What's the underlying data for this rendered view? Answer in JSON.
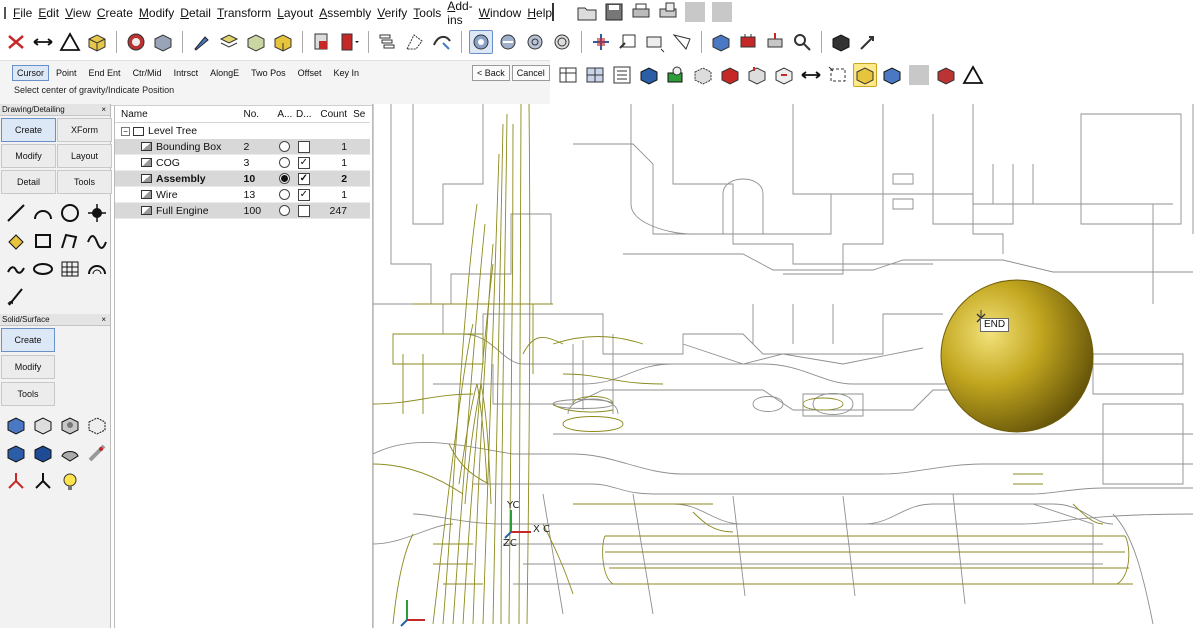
{
  "menubar": {
    "items": [
      "File",
      "Edit",
      "View",
      "Create",
      "Modify",
      "Detail",
      "Transform",
      "Layout",
      "Assembly",
      "Verify",
      "Tools",
      "Add-ins",
      "Window",
      "Help"
    ]
  },
  "snap_bar": {
    "modes": [
      "Cursor",
      "Point",
      "End Ent",
      "Ctr/Mid",
      "Intrsct",
      "AlongE",
      "Two Pos",
      "Offset",
      "Key In"
    ],
    "active_mode": "Cursor",
    "back_label": "< Back",
    "cancel_label": "Cancel",
    "prompt": "Select center of gravity/Indicate Position"
  },
  "palette": {
    "drawing_title": "Drawing/Detailing",
    "drawing_tabs": [
      "Create",
      "XForm",
      "Modify",
      "Layout",
      "Detail",
      "Tools"
    ],
    "solid_title": "Solid/Surface",
    "solid_tabs": [
      "Create",
      "Modify",
      "Tools"
    ],
    "close_glyph": "×"
  },
  "level_tree": {
    "columns": {
      "name": "Name",
      "no": "No.",
      "active": "A...",
      "display": "D...",
      "count": "Count",
      "se": "Se"
    },
    "root_label": "Level Tree",
    "rows": [
      {
        "name": "Bounding Box",
        "no": "2",
        "count": "1",
        "display": false,
        "active": false,
        "bold": false
      },
      {
        "name": "COG",
        "no": "3",
        "count": "1",
        "display": true,
        "active": false,
        "bold": false
      },
      {
        "name": "Assembly",
        "no": "10",
        "count": "2",
        "display": true,
        "active": true,
        "bold": true
      },
      {
        "name": "Wire",
        "no": "13",
        "count": "1",
        "display": true,
        "active": false,
        "bold": false
      },
      {
        "name": "Full Engine",
        "no": "100",
        "count": "247",
        "display": false,
        "active": false,
        "bold": false
      }
    ]
  },
  "viewport": {
    "snap_tip": "END",
    "triad_labels": {
      "x": "X C",
      "y": "YC",
      "z": "ZC"
    },
    "wire_color": "#8c8a1e",
    "sphere_color": "#b8a21a"
  },
  "toolbar_icons": [
    "point-icon",
    "line-icon",
    "triangle-icon",
    "box-icon",
    "render-icon",
    "shade-icon",
    "brush-icon",
    "layer-icon",
    "color-icon",
    "plane-icon",
    "spline-icon",
    "view-rotate-icon",
    "gear-icon",
    "move-icon",
    "cursor-icon",
    "dimension-icon",
    "measure-icon",
    "assembly-icon",
    "zoom-icon",
    "sphere-icon"
  ]
}
